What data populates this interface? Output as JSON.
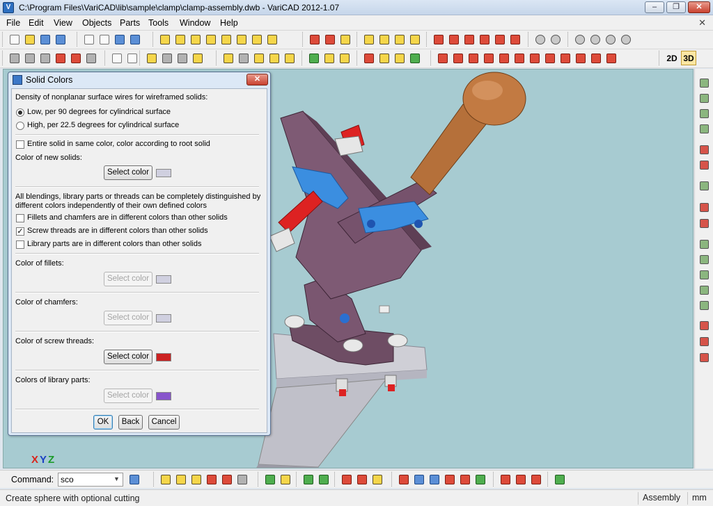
{
  "window": {
    "title": "C:\\Program Files\\VariCAD\\lib\\sample\\clamp\\clamp-assembly.dwb - VariCAD 2012-1.07",
    "minimize": "–",
    "maximize": "❐",
    "close": "✕"
  },
  "menu": {
    "items": [
      "File",
      "Edit",
      "View",
      "Objects",
      "Parts",
      "Tools",
      "Window",
      "Help"
    ],
    "mdi_close": "✕"
  },
  "toolbar": {
    "mode_2d": "2D",
    "mode_3d": "3D",
    "active_mode": "3D"
  },
  "viewport": {
    "axis_x": "X",
    "axis_y": "Y",
    "axis_z": "Z",
    "background_color": "#a7cbd1"
  },
  "dialog": {
    "title": "Solid Colors",
    "close": "✕",
    "density_heading": "Density of nonplanar surface wires for wireframed solids:",
    "radio_low": "Low, per 90 degrees for cylindrical surface",
    "radio_high": "High, per 22.5 degrees for cylindrical surface",
    "density_selected": "low",
    "entire_solid_label": "Entire solid in same color, color according to root solid",
    "entire_solid_checked": false,
    "new_solids_label": "Color of new solids:",
    "select_color": "Select color",
    "new_solids_color": "#d0d0e0",
    "distinguish_line1": "All blendings, library parts or threads can be completely distinguished by",
    "distinguish_line2": "different colors independently of their own defined colors",
    "fillets_checkbox": "Fillets and chamfers are in different colors than other solids",
    "fillets_checked": false,
    "threads_checkbox": "Screw threads are in different colors than other solids",
    "threads_checked": true,
    "library_checkbox": "Library parts are in different colors than other solids",
    "library_checked": false,
    "fillets_label": "Color of fillets:",
    "fillets_color": "#d0d0e0",
    "chamfers_label": "Color of chamfers:",
    "chamfers_color": "#d0d0e0",
    "threads_label": "Color of screw threads:",
    "threads_color": "#cc2222",
    "library_label": "Colors of library parts:",
    "library_color": "#8855cc",
    "ok": "OK",
    "back": "Back",
    "cancel": "Cancel"
  },
  "command": {
    "label": "Command:",
    "value": "sco",
    "dropdown": "▼"
  },
  "status": {
    "message": "Create sphere with optional cutting",
    "mode": "Assembly",
    "units": "mm"
  }
}
